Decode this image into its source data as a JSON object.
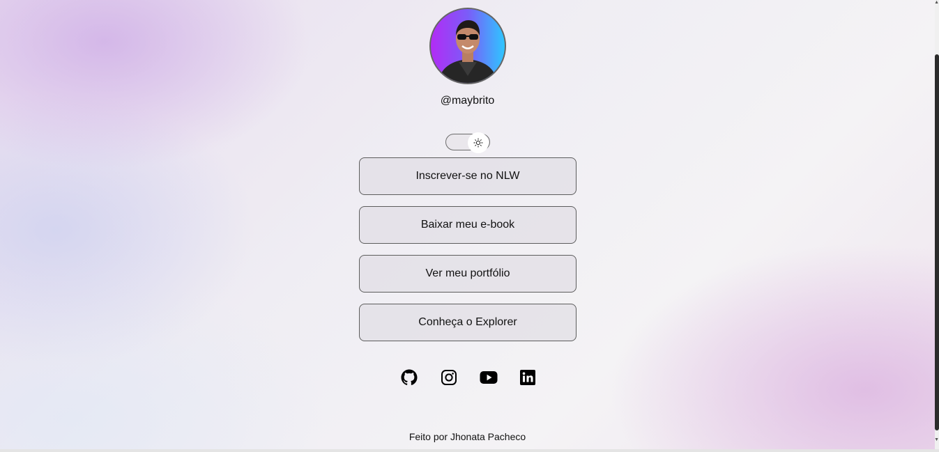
{
  "profile": {
    "username": "@maybrito",
    "avatar_alt": "profile photo"
  },
  "theme_switch": {
    "icon": "sun-icon",
    "mode": "light"
  },
  "links": [
    {
      "label": "Inscrever-se no NLW"
    },
    {
      "label": "Baixar meu e-book"
    },
    {
      "label": "Ver meu portfólio"
    },
    {
      "label": "Conheça o Explorer"
    }
  ],
  "social": [
    {
      "icon": "github-icon"
    },
    {
      "icon": "instagram-icon"
    },
    {
      "icon": "youtube-icon"
    },
    {
      "icon": "linkedin-icon"
    }
  ],
  "footer": {
    "credit": "Feito por Jhonata Pacheco"
  }
}
